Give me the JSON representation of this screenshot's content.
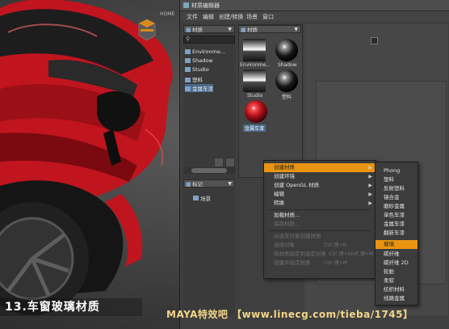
{
  "window": {
    "title": "材质编辑器",
    "menu": [
      "文件",
      "编辑",
      "创建/转换",
      "场景",
      "窗口"
    ]
  },
  "left_panel": {
    "dropdown": "材质",
    "tree": [
      "Environme...",
      "Shadow",
      "Studio",
      "塑料",
      "金属车漆"
    ],
    "bottom_dropdown": "标记",
    "scene_item": "场景"
  },
  "swatches": [
    "Environme...",
    "Shadow",
    "Studio",
    "塑料",
    "金属车漆"
  ],
  "mid_dropdown": "材质",
  "viewport": {
    "cube_label": "HOME"
  },
  "context_menu": {
    "items": [
      {
        "label": "创建材质",
        "state": "highlighted",
        "arrow": true
      },
      {
        "label": "创建环境",
        "state": "normal",
        "arrow": true
      },
      {
        "label": "创建 OpenGL 材质",
        "state": "normal",
        "arrow": true
      },
      {
        "label": "编辑",
        "state": "normal",
        "arrow": true
      },
      {
        "label": "转换",
        "state": "normal",
        "arrow": true
      },
      {
        "label": "加载材质...",
        "state": "normal",
        "arrow": false
      },
      {
        "label": "保存材质...",
        "state": "disabled",
        "arrow": false
      },
      {
        "label": "从选定对象创建材质",
        "state": "disabled",
        "arrow": false
      },
      {
        "label": "选择对象",
        "state": "disabled",
        "arrow": false,
        "shortcut": "Ctrl 键+N"
      },
      {
        "label": "将材质指定到选定对象",
        "state": "disabled",
        "arrow": false,
        "shortcut": "Ctrl 键+Shift 键+M"
      },
      {
        "label": "创建并指定材质",
        "state": "disabled",
        "arrow": false,
        "shortcut": "Ctrl 键+M"
      }
    ]
  },
  "submenu": {
    "items": [
      "Phong",
      "塑料",
      "反射塑料",
      "镜合金",
      "磨砂金属",
      "单色车漆",
      "金属车漆",
      "翻新车漆",
      "玻璃",
      "碳纤维",
      "碳纤维 2D",
      "轮胎",
      "柔软",
      "纺织材料",
      "线路金属"
    ],
    "highlighted": "玻璃"
  },
  "caption": {
    "left": "13.车窗玻璃材质",
    "right": "MAYA特效吧 【www.linecg.com/tieba/1745】"
  },
  "colors": {
    "accent": "#e99512",
    "car_red": "#c0141e"
  }
}
